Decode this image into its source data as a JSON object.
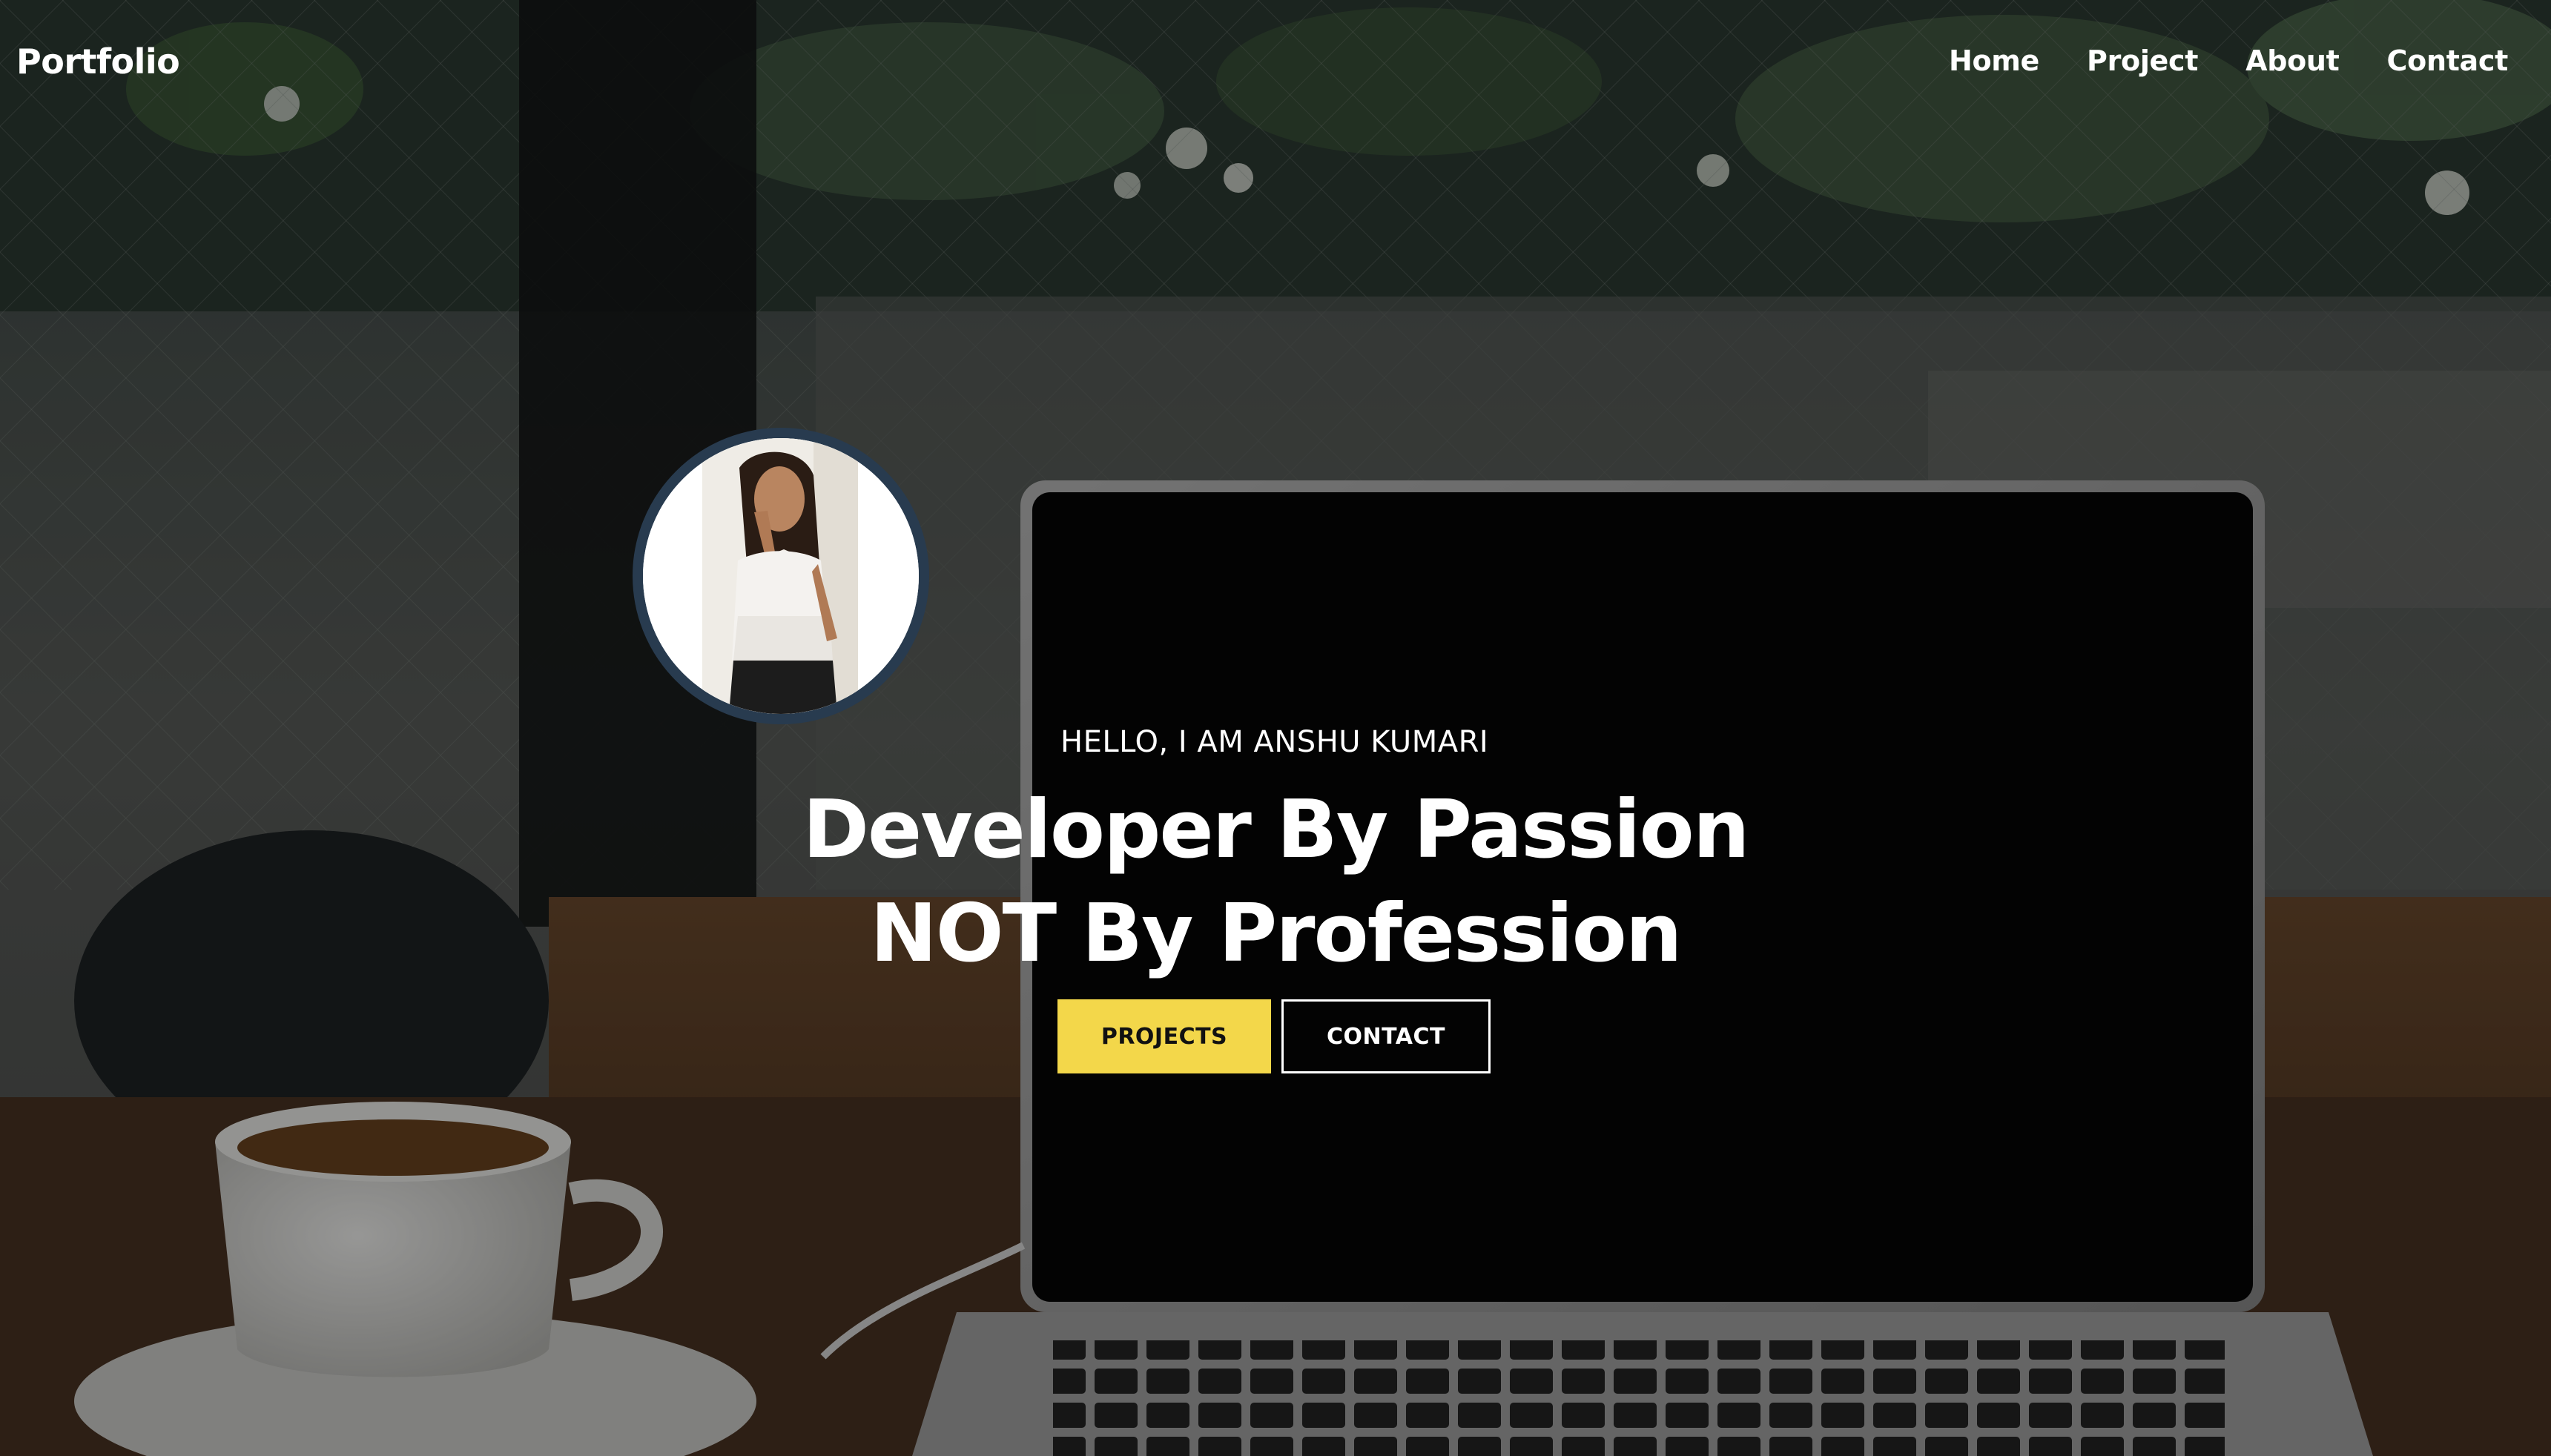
{
  "navbar": {
    "brand": "Portfolio",
    "links": [
      "Home",
      "Project",
      "About",
      "Contact"
    ]
  },
  "hero": {
    "greeting": "HELLO, I AM ANSHU KUMARI",
    "title": "Developer By Passion NOT By Profession",
    "buttons": {
      "projects": "PROJECTS",
      "contact": "CONTACT"
    }
  },
  "colors": {
    "accent": "#f3d74a",
    "avatar_ring": "#283b4f",
    "text": "#ffffff"
  }
}
